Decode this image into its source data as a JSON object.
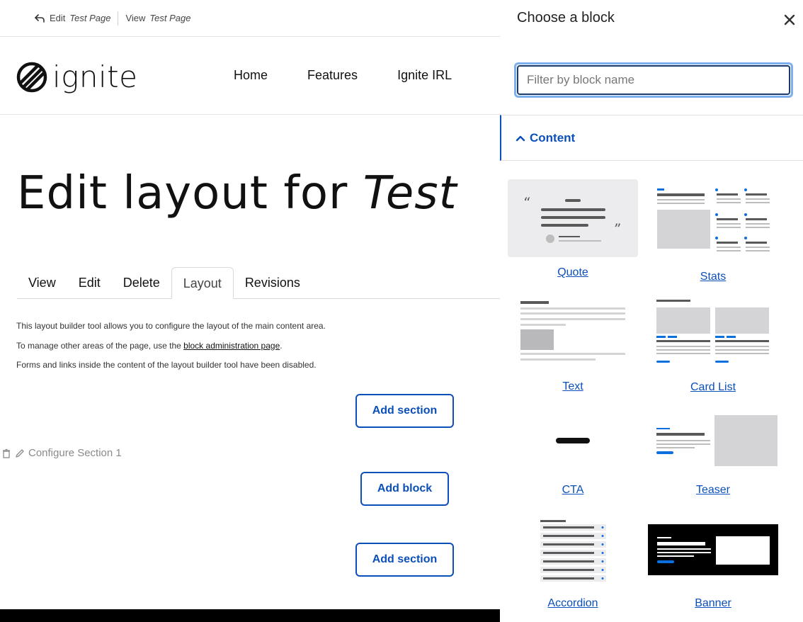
{
  "toolbar": {
    "edit_prefix": "Edit",
    "edit_title": "Test Page",
    "view_prefix": "View",
    "view_title": "Test Page"
  },
  "header": {
    "logo_text": "ignite",
    "nav": [
      "Home",
      "Features",
      "Ignite IRL"
    ]
  },
  "page": {
    "title_prefix": "Edit layout for",
    "title_em": "Test"
  },
  "tabs": [
    {
      "label": "View",
      "active": false
    },
    {
      "label": "Edit",
      "active": false
    },
    {
      "label": "Delete",
      "active": false
    },
    {
      "label": "Layout",
      "active": true
    },
    {
      "label": "Revisions",
      "active": false
    }
  ],
  "help": {
    "line1": "This layout builder tool allows you to configure the layout of the main content area.",
    "line2_prefix": "To manage other areas of the page, use the",
    "line2_link": "block administration page",
    "line2_suffix": ".",
    "line3": "Forms and links inside the content of the layout builder tool have been disabled."
  },
  "layout_builder": {
    "add_section": "Add section",
    "add_block": "Add block",
    "configure_section": "Configure Section 1"
  },
  "panel": {
    "title": "Choose a block",
    "filter_placeholder": "Filter by block name",
    "filter_value": "",
    "section_label": "Content",
    "blocks": [
      {
        "label": "Quote",
        "icon": "quote-thumbnail"
      },
      {
        "label": "Stats",
        "icon": "stats-thumbnail"
      },
      {
        "label": "Text",
        "icon": "text-thumbnail"
      },
      {
        "label": "Card List",
        "icon": "card-list-thumbnail"
      },
      {
        "label": "CTA",
        "icon": "cta-thumbnail"
      },
      {
        "label": "Teaser",
        "icon": "teaser-thumbnail"
      },
      {
        "label": "Accordion",
        "icon": "accordion-thumbnail"
      },
      {
        "label": "Banner",
        "icon": "banner-thumbnail"
      }
    ]
  },
  "colors": {
    "accent": "#0b4fb8",
    "focus_ring": "#7fb0ee",
    "thumb_gray": "#d4d4d6",
    "thumb_line": "#595959"
  }
}
